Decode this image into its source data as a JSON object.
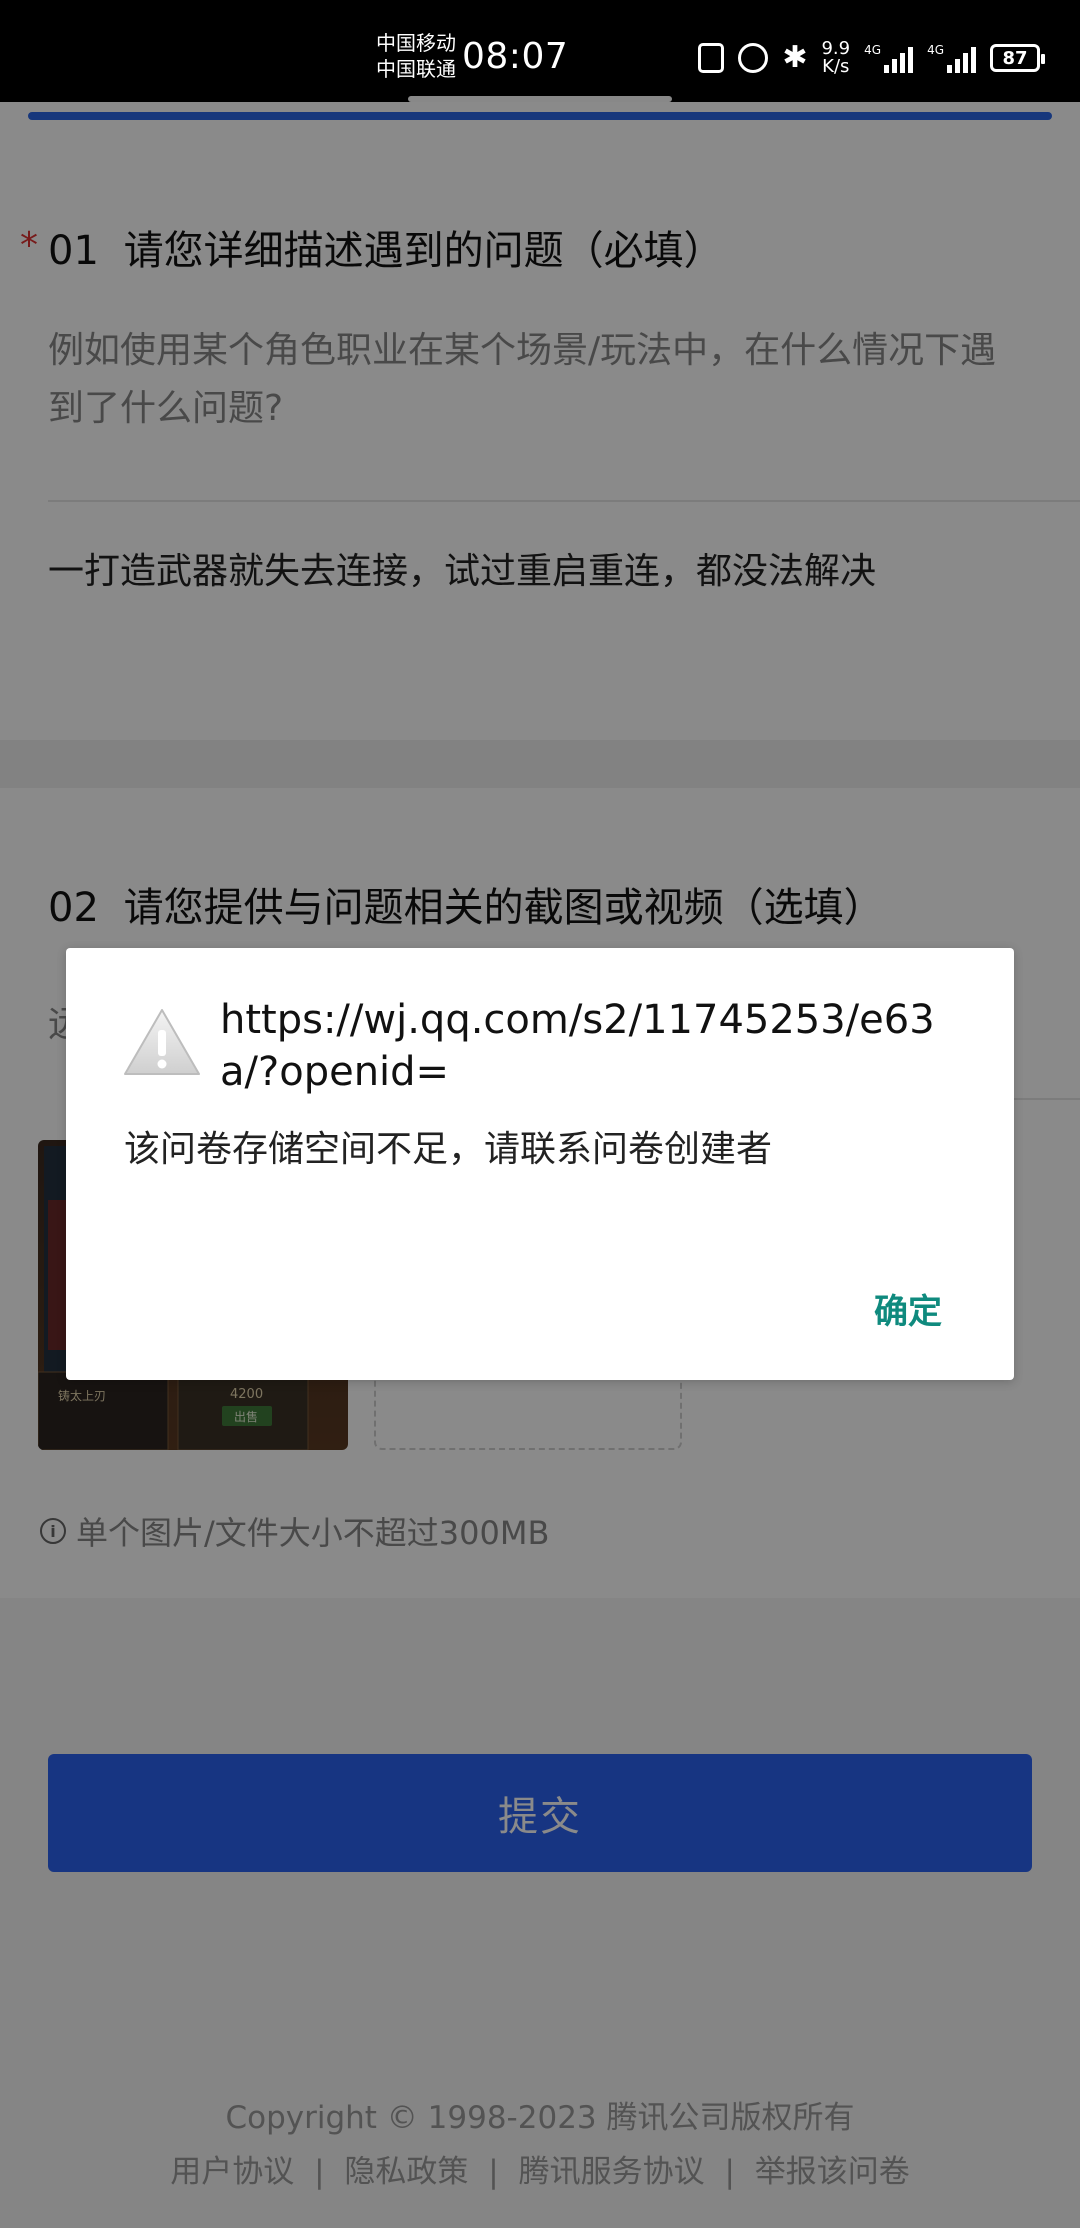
{
  "status_bar": {
    "carrier1": "中国移动",
    "carrier2": "中国联通",
    "time": "08:07",
    "speed_top": "9.9",
    "speed_bottom": "K/s",
    "net1": "4G",
    "net2": "4G",
    "battery": "87"
  },
  "question1": {
    "number": "01",
    "star": "*",
    "title": "请您详细描述遇到的问题（必填）",
    "hint": "例如使用某个角色职业在某个场景/玩法中，在什么情况下遇到了什么问题?",
    "answer": "一打造武器就失去连接，试过重启重连，都没法解决"
  },
  "question2": {
    "number": "02",
    "title": "请您提供与问题相关的截图或视频（选填）",
    "upload_hint_visible": "远",
    "thumb_labels": [
      "铸太上刃",
      "4200",
      "出售"
    ],
    "size_note": "单个图片/文件大小不超过300MB"
  },
  "submit_label": "提交",
  "footer": {
    "copyright": "Copyright © 1998-2023 腾讯公司版权所有",
    "links": [
      "用户协议",
      "隐私政策",
      "腾讯服务协议",
      "举报该问卷"
    ],
    "separator": "|"
  },
  "dialog": {
    "title": "https://wj.qq.com/s2/11745253/e63a/?openid=",
    "message": "该问卷存储空间不足，请联系问卷创建者",
    "ok_label": "确定",
    "icon": "warning-icon"
  },
  "colors": {
    "accent": "#2b63f0",
    "dialog_button": "#0f8a7e",
    "required": "#dd3333"
  }
}
